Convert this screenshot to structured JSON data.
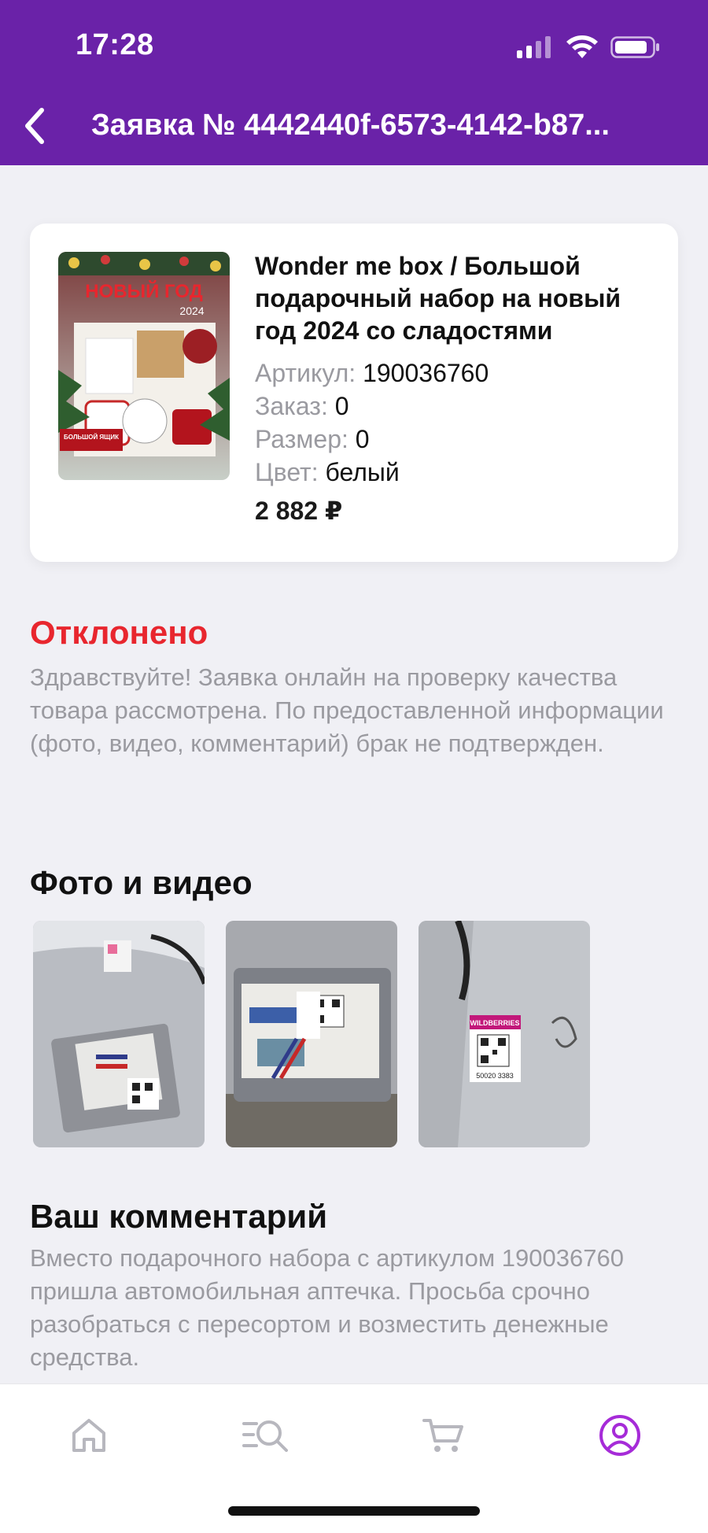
{
  "status_bar": {
    "time": "17:28"
  },
  "nav": {
    "title": "Заявка № 4442440f-6573-4142-b87..."
  },
  "product": {
    "title": "Wonder me box / Большой подарочный набор на новый год 2024 со сладостями",
    "image_text": {
      "headline": "НОВЫЙ ГОД",
      "year": "2024",
      "badge": "БОЛЬШОЙ ЯЩИК"
    },
    "attributes": [
      {
        "label": "Артикул:",
        "value": "190036760"
      },
      {
        "label": "Заказ:",
        "value": "0"
      },
      {
        "label": "Размер:",
        "value": "0"
      },
      {
        "label": "Цвет:",
        "value": "белый"
      }
    ],
    "price": "2 882 ₽"
  },
  "status": {
    "title": "Отклонено",
    "title_color": "#e8262e",
    "message": "Здравствуйте! Заявка онлайн на проверку качества товара рассмотрена. По предоставленной информации (фото, видео, комментарий) брак не подтвержден."
  },
  "photos_section": {
    "title": "Фото и видео",
    "photos": [
      {
        "icon": "photo-package-1"
      },
      {
        "icon": "photo-package-2"
      },
      {
        "icon": "photo-package-3",
        "label_text": "WILDBERRIES",
        "code_text": "50020 3383"
      }
    ]
  },
  "comment_section": {
    "title": "Ваш комментарий",
    "text": "Вместо подарочного набора с артикулом 190036760 пришла автомобильная аптечка. Просьба срочно разобраться с пересортом и возместить денежные средства."
  },
  "tab_bar": {
    "tabs": [
      {
        "icon": "home-icon",
        "active": false
      },
      {
        "icon": "catalog-search-icon",
        "active": false
      },
      {
        "icon": "cart-icon",
        "active": false
      },
      {
        "icon": "profile-icon",
        "active": true
      }
    ],
    "active_color": "#a62bd8",
    "inactive_color": "#b7b7be"
  },
  "colors": {
    "header_bg": "#6a22a8",
    "page_bg": "#f0f0f5",
    "muted_text": "#9a9aa0"
  }
}
